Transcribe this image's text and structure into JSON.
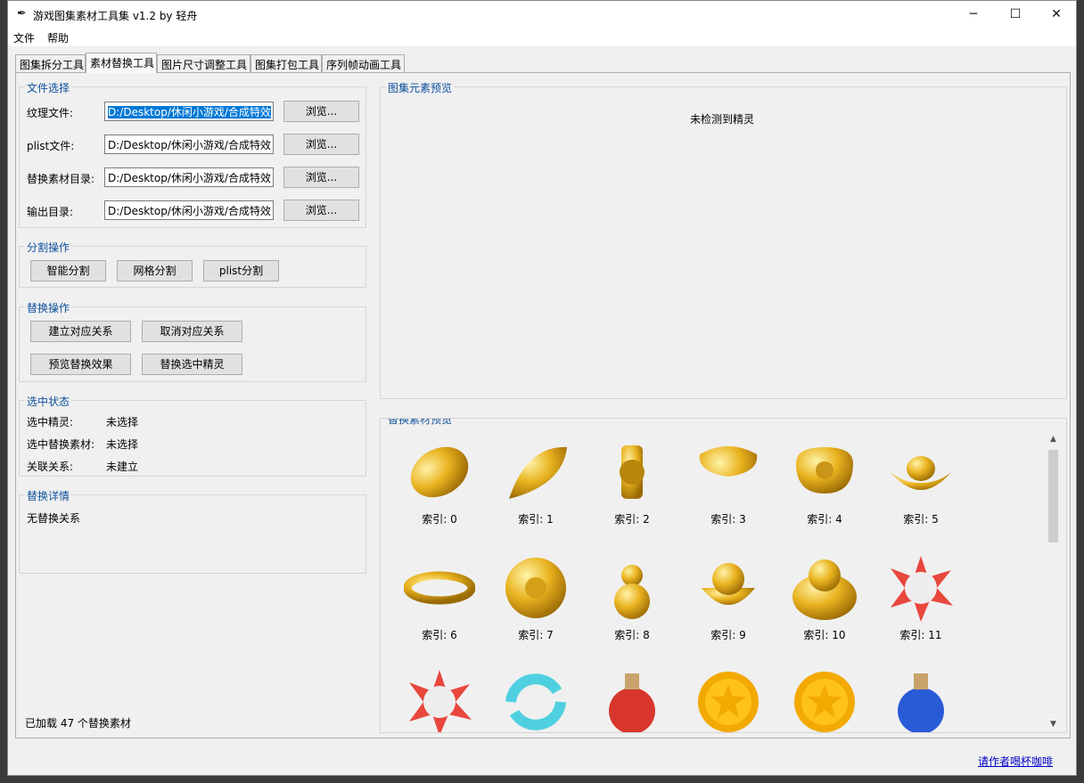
{
  "window": {
    "title": "游戏图集素材工具集 v1.2 by 轻舟",
    "icon": "feather-icon"
  },
  "menu": [
    "文件",
    "帮助"
  ],
  "tabs": [
    "图集拆分工具",
    "素材替换工具",
    "图片尺寸调整工具",
    "图集打包工具",
    "序列帧动画工具"
  ],
  "active_tab": 1,
  "file_section": {
    "title": "文件选择",
    "rows": [
      {
        "label": "纹理文件:",
        "value": "D:/Desktop/休闲小游戏/合成特效",
        "button": "浏览..."
      },
      {
        "label": "plist文件:",
        "value": "D:/Desktop/休闲小游戏/合成特效",
        "button": "浏览..."
      },
      {
        "label": "替换素材目录:",
        "value": "D:/Desktop/休闲小游戏/合成特效",
        "button": "浏览..."
      },
      {
        "label": "输出目录:",
        "value": "D:/Desktop/休闲小游戏/合成特效",
        "button": "浏览..."
      }
    ]
  },
  "split_section": {
    "title": "分割操作",
    "buttons": [
      "智能分割",
      "网格分割",
      "plist分割"
    ]
  },
  "replace_section": {
    "title": "替换操作",
    "buttons": [
      "建立对应关系",
      "取消对应关系",
      "预览替换效果",
      "替换选中精灵"
    ]
  },
  "status_section": {
    "title": "选中状态",
    "rows": [
      {
        "label": "选中精灵:",
        "value": "未选择"
      },
      {
        "label": "选中替换素材:",
        "value": "未选择"
      },
      {
        "label": "关联关系:",
        "value": "未建立"
      }
    ]
  },
  "detail_section": {
    "title": "替换详情",
    "text": "无替换关系"
  },
  "loaded_status": "已加载 47 个替换素材",
  "atlas_preview": {
    "title": "图集元素预览",
    "empty_text": "未检测到精灵"
  },
  "material_preview": {
    "title": "替换素材预览",
    "items": [
      {
        "caption": "索引: 0",
        "icon": "gold-bean-icon"
      },
      {
        "caption": "索引: 1",
        "icon": "gold-seed-icon"
      },
      {
        "caption": "索引: 2",
        "icon": "gold-elephant-vase-icon"
      },
      {
        "caption": "索引: 3",
        "icon": "gold-ginkgo-leaf-icon"
      },
      {
        "caption": "索引: 4",
        "icon": "gold-lock-icon"
      },
      {
        "caption": "索引: 5",
        "icon": "gold-ingot-icon"
      },
      {
        "caption": "索引: 6",
        "icon": "gold-bracelet-icon"
      },
      {
        "caption": "索引: 7",
        "icon": "gold-flower-icon"
      },
      {
        "caption": "索引: 8",
        "icon": "gold-gourd-icon"
      },
      {
        "caption": "索引: 9",
        "icon": "treasure-bowl-icon"
      },
      {
        "caption": "索引: 10",
        "icon": "laughing-buddha-icon"
      },
      {
        "caption": "索引: 11",
        "icon": "explosion-icon"
      },
      {
        "caption": "",
        "icon": "explosion-icon"
      },
      {
        "caption": "",
        "icon": "refresh-arrows-icon"
      },
      {
        "caption": "",
        "icon": "red-potion-icon"
      },
      {
        "caption": "",
        "icon": "gold-star-coin-icon"
      },
      {
        "caption": "",
        "icon": "gold-star-coin-icon"
      },
      {
        "caption": "",
        "icon": "blue-potion-icon"
      }
    ]
  },
  "footer_link": "请作者喝杯咖啡",
  "colors": {
    "accent_title": "#0d4f9c",
    "selection": "#0078d7",
    "link": "#0000cc"
  }
}
